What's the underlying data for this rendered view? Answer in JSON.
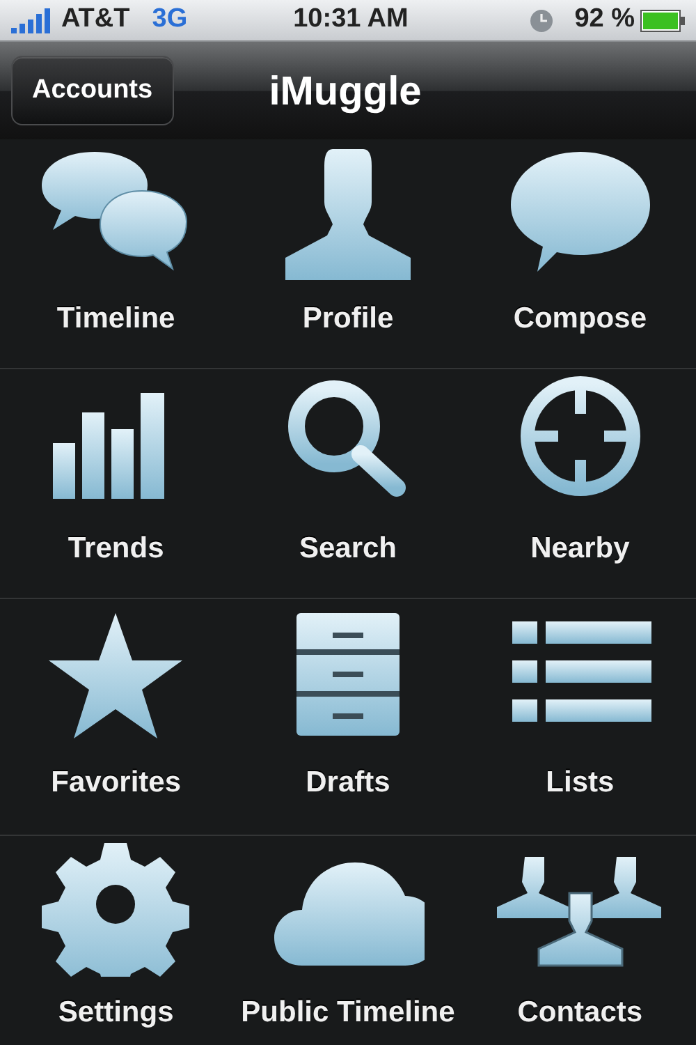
{
  "status_bar": {
    "carrier": "AT&T",
    "network": "3G",
    "time": "10:31 AM",
    "battery": "92 %"
  },
  "nav_bar": {
    "back_button": "Accounts",
    "title": "iMuggle"
  },
  "menu": [
    {
      "label": "Timeline"
    },
    {
      "label": "Profile"
    },
    {
      "label": "Compose"
    },
    {
      "label": "Trends"
    },
    {
      "label": "Search"
    },
    {
      "label": "Nearby"
    },
    {
      "label": "Favorites"
    },
    {
      "label": "Drafts"
    },
    {
      "label": "Lists"
    },
    {
      "label": "Settings"
    },
    {
      "label": "Public Timeline"
    },
    {
      "label": "Contacts"
    }
  ]
}
